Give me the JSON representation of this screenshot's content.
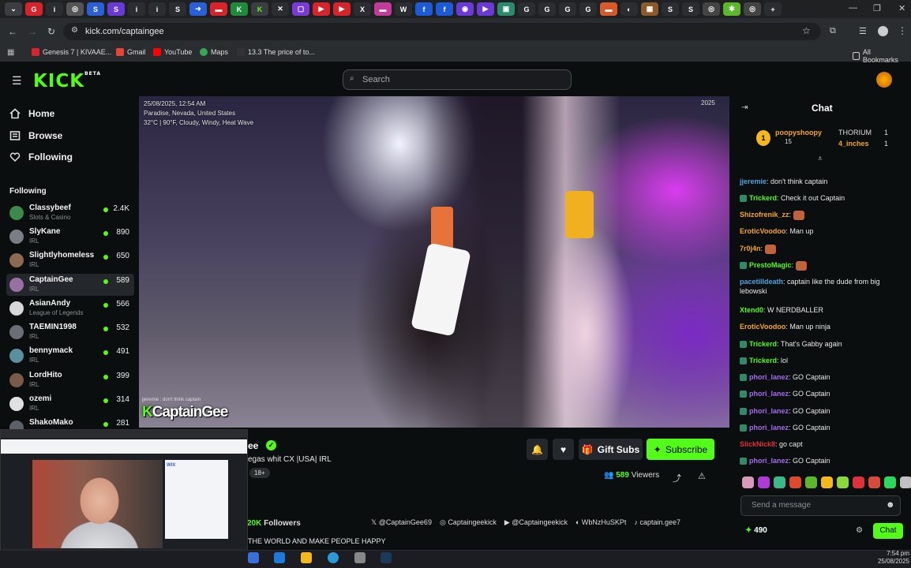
{
  "browser": {
    "url": "kick.com/captaingee",
    "bookmarks": [
      "Genesis 7 | KIVAAE...",
      "Gmail",
      "YouTube",
      "Maps",
      "13.3 The price of to..."
    ],
    "all_bookmarks": "All Bookmarks"
  },
  "header": {
    "logo": "KICK",
    "logo_beta": "BETA",
    "search_placeholder": "Search"
  },
  "sidebar": {
    "nav": [
      "Home",
      "Browse",
      "Following"
    ],
    "following_heading": "Following",
    "channels": [
      {
        "name": "Classybeef",
        "category": "Slots & Casino",
        "viewers": "2.4K",
        "color": "#3a8a4a"
      },
      {
        "name": "SlyKane",
        "category": "IRL",
        "viewers": "890",
        "color": "#7a7f86"
      },
      {
        "name": "Slightlyhomeless",
        "category": "IRL",
        "viewers": "650",
        "color": "#8d6a50"
      },
      {
        "name": "CaptainGee",
        "category": "IRL",
        "viewers": "589",
        "color": "#9a6fa6"
      },
      {
        "name": "AsianAndy",
        "category": "League of Legends",
        "viewers": "566",
        "color": "#d8d8d8"
      },
      {
        "name": "TAEMIN1998",
        "category": "IRL",
        "viewers": "532",
        "color": "#6b6f75"
      },
      {
        "name": "bennymack",
        "category": "IRL",
        "viewers": "491",
        "color": "#5a8fa0"
      },
      {
        "name": "LordHito",
        "category": "IRL",
        "viewers": "399",
        "color": "#7a5a48"
      },
      {
        "name": "ozemi",
        "category": "IRL",
        "viewers": "314",
        "color": "#e0e0e0"
      },
      {
        "name": "ShakoMako",
        "category": "",
        "viewers": "281",
        "color": "#5c6068"
      }
    ]
  },
  "video": {
    "date": "25/08/2025, 12:54 AM",
    "location": "Paradise, Nevada, United States",
    "weather": "32°C | 90°F, Cloudy, Windy, Heat Wave",
    "watermark_prefix": "K",
    "watermark": "CaptainGee",
    "overlay_chat": "jjeremie : don't think captain",
    "corner_tag": "2025"
  },
  "stream": {
    "name_partial": "ee",
    "title": "egas whit CX  |USA| IRL",
    "age_tag": "18+",
    "gift_subs": "Gift Subs",
    "subscribe": "Subscribe",
    "viewers_count": "589",
    "viewers_label": "Viewers",
    "followers_count": "20K",
    "followers_label": "Followers",
    "socials": [
      "@CaptainGee69",
      "Captaingeekick",
      "@Captaingeekick",
      "WbNzHuSKPt",
      "captain.gee7"
    ],
    "bio": "THE WORLD AND MAKE PEOPLE HAPPY"
  },
  "chat": {
    "title": "Chat",
    "pinned": [
      {
        "name": "poopyshoopy",
        "value": "15"
      },
      {
        "name": "THORIUM",
        "value": "1"
      },
      {
        "name": "4_inches",
        "value": "1"
      }
    ],
    "messages": [
      {
        "user": "jjeremie",
        "text": "don't think captain",
        "color": "#4fa3e0"
      },
      {
        "user": "Trickerd",
        "text": "Check it out Captain",
        "color": "#53fc18"
      },
      {
        "user": "Shizofrenik_zz",
        "text": "",
        "color": "#f5a623"
      },
      {
        "user": "EroticVoodoo",
        "text": "Man up",
        "color": "#f5a623"
      },
      {
        "user": "7r0j4n",
        "text": "",
        "color": "#f5a623"
      },
      {
        "user": "PrestoMagic",
        "text": "",
        "color": "#53fc18"
      },
      {
        "user": "pacetilldeath",
        "text": "captain like the dude from big lebowski",
        "color": "#4fa3e0"
      },
      {
        "user": "Xtend0",
        "text": "W NERDBALLER",
        "color": "#53fc18"
      },
      {
        "user": "EroticVoodoo",
        "text": "Man up ninja",
        "color": "#f5a623"
      },
      {
        "user": "Trickerd",
        "text": "That's Gabby again",
        "color": "#53fc18"
      },
      {
        "user": "Trickerd",
        "text": "lol",
        "color": "#53fc18"
      },
      {
        "user": "phori_lanez",
        "text": "GO Captain",
        "color": "#a56cf0"
      },
      {
        "user": "phori_lanez",
        "text": "GO Captain",
        "color": "#a56cf0"
      },
      {
        "user": "phori_lanez",
        "text": "GO Captain",
        "color": "#a56cf0"
      },
      {
        "user": "phori_lanez",
        "text": "GO Captain",
        "color": "#a56cf0"
      },
      {
        "user": "SlickNick8",
        "text": "go capt",
        "color": "#e0303a"
      },
      {
        "user": "phori_lanez",
        "text": "GO Captain",
        "color": "#a56cf0"
      }
    ],
    "input_placeholder": "Send a message",
    "points": "490",
    "send": "Chat"
  },
  "taskbar": {
    "time": "7:54 pm",
    "date": "25/08/2025"
  },
  "colors": {
    "accent": "#53fc18",
    "bg": "#0b0e0f"
  }
}
